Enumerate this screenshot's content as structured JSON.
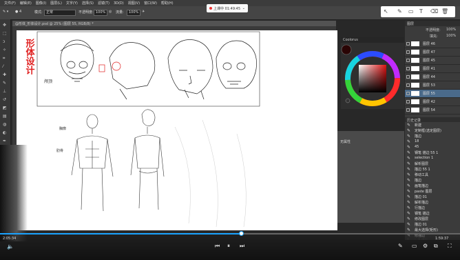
{
  "menubar": [
    "文件(F)",
    "编辑(E)",
    "图像(I)",
    "图层(L)",
    "文字(Y)",
    "选择(S)",
    "滤镜(T)",
    "3D(D)",
    "视图(V)",
    "窗口(W)",
    "帮助(H)"
  ],
  "options": {
    "mode_label": "模式:",
    "mode_value": "正常",
    "opacity_label": "不透明度:",
    "opacity_value": "100%",
    "flow_label": "流量:",
    "flow_value": "100%"
  },
  "recording": {
    "label": "上课中 01:49:45"
  },
  "document": {
    "tab": "@形体_形体设计.psd @ 25% (图层 55, RGB/8) *"
  },
  "canvas": {
    "title": "形体设计",
    "note1": "颅顶",
    "note2": "胸廓",
    "note3": "肋骨"
  },
  "palette": {
    "header": "Coolorus"
  },
  "properties": {
    "label": "无属性"
  },
  "layers": {
    "tab": "图层",
    "opacity_label": "不透明度:",
    "opacity_value": "100%",
    "fill_label": "填充:",
    "fill_value": "100%",
    "items": [
      "图层 46",
      "图层 47",
      "图层 45",
      "图层 41",
      "图层 44",
      "图层 53",
      "图层 55",
      "图层 42",
      "图层 54"
    ]
  },
  "history": {
    "tab": "历史记录",
    "items": [
      "新建",
      "定制框(选定图层)",
      "描边",
      "18",
      "45",
      "钢笔 描边 55 1",
      "selection 1",
      "解析图层",
      "描边 55 1",
      "移动工具",
      "描边",
      "画笔描边",
      "paste 图层",
      "描边 01",
      "解析描边",
      "行描边",
      "钢笔 描边",
      "修改图层",
      "描边 01",
      "最大选择(矩形)",
      "修描边",
      "切换描边"
    ]
  },
  "video": {
    "current": "2:05:34",
    "total": "1:59:37",
    "progress_pct": 52.5
  },
  "colors": {
    "accent": "#1aa3ff",
    "title_red": "#e02020"
  }
}
